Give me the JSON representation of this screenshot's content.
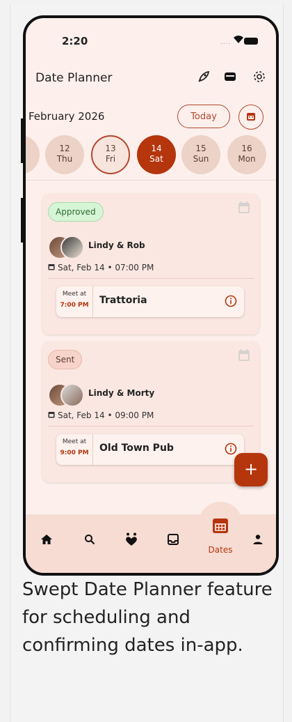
{
  "status_bar": {
    "time": "2:20",
    "signal_dots": "...."
  },
  "header": {
    "title": "Date Planner",
    "icons": [
      "rocket-icon",
      "wallet-icon",
      "gear-icon"
    ]
  },
  "calendar": {
    "month": "February 2026",
    "today_label": "Today",
    "days": [
      {
        "num": "12",
        "dow": "Thu"
      },
      {
        "num": "13",
        "dow": "Fri"
      },
      {
        "num": "14",
        "dow": "Sat"
      },
      {
        "num": "15",
        "dow": "Sun"
      },
      {
        "num": "16",
        "dow": "Mon"
      }
    ],
    "selected": "14",
    "today": "13"
  },
  "dates": [
    {
      "status": "Approved",
      "names": "Lindy & Rob",
      "when": "Sat, Feb 14 • 07:00 PM",
      "meet_label": "Meet at",
      "meet_time": "7:00 PM",
      "venue": "Trattoria"
    },
    {
      "status": "Sent",
      "names": "Lindy & Morty",
      "when": "Sat, Feb 14 • 09:00 PM",
      "meet_label": "Meet at",
      "meet_time": "9:00 PM",
      "venue": "Old Town Pub"
    }
  ],
  "fab_label": "+",
  "nav": {
    "items": [
      "home-icon",
      "search-icon",
      "hearts-icon",
      "inbox-icon",
      "dates-icon",
      "profile-icon"
    ],
    "active_label": "Dates"
  },
  "colors": {
    "accent": "#b5350d",
    "background": "#fdf0ec",
    "nav": "#f6dcd3"
  },
  "caption": "Swept Date Planner feature for scheduling and confirming dates in-app."
}
